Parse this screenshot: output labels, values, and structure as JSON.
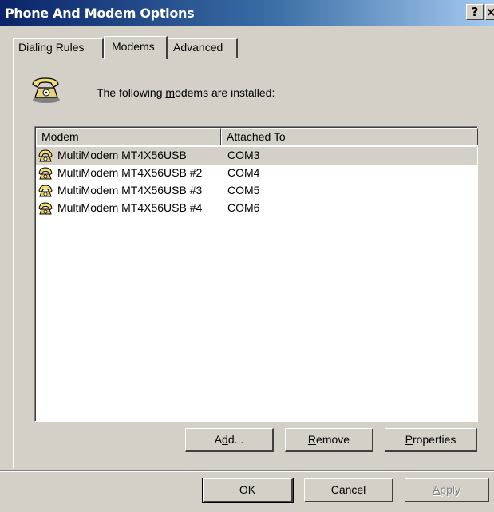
{
  "window": {
    "title": "Phone And Modem Options",
    "help_label": "?",
    "close_label": "×"
  },
  "tabs": [
    {
      "label": "Dialing Rules",
      "selected": false
    },
    {
      "label": "Modems",
      "selected": true
    },
    {
      "label": "Advanced",
      "selected": false
    }
  ],
  "modems_tab": {
    "intro_prefix": "The following ",
    "intro_accel": "m",
    "intro_rest": "odems are  installed:",
    "icon": "telephone-icon",
    "columns": [
      "Modem",
      "Attached To"
    ],
    "rows": [
      {
        "modem": "MultiModem MT4X56USB",
        "port": "COM3",
        "selected": true
      },
      {
        "modem": "MultiModem MT4X56USB #2",
        "port": "COM4",
        "selected": false
      },
      {
        "modem": "MultiModem MT4X56USB #3",
        "port": "COM5",
        "selected": false
      },
      {
        "modem": "MultiModem MT4X56USB #4",
        "port": "COM6",
        "selected": false
      }
    ],
    "row_icon": "modem-icon",
    "buttons": {
      "add": {
        "pre": "A",
        "accel": "d",
        "post": "d..."
      },
      "remove": {
        "pre": "",
        "accel": "R",
        "post": "emove"
      },
      "properties": {
        "pre": "",
        "accel": "P",
        "post": "roperties"
      }
    }
  },
  "footer": {
    "ok_label": "OK",
    "cancel_label": "Cancel",
    "apply": {
      "pre": "",
      "accel": "A",
      "post": "pply",
      "enabled": false
    }
  },
  "colors": {
    "titlebar_start": "#0a246a",
    "titlebar_end": "#a6caf0",
    "face": "#d4d0c8"
  }
}
